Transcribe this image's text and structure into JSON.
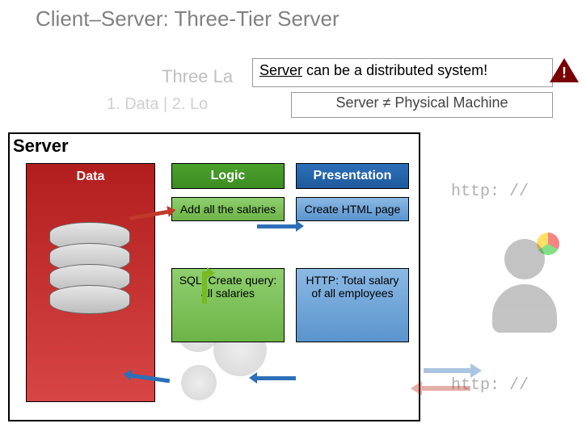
{
  "title": "Client–Server: Three-Tier Server",
  "subtitle_bg": "Three La",
  "layers_bg": "1. Data | 2. Lo",
  "callout1_prefix": "Server",
  "callout1_rest": " can be a distributed system!",
  "callout2": "Server ≠ Physical Machine",
  "warning": "!",
  "server_label": "Server",
  "col_data": "Data",
  "col_logic": "Logic",
  "col_pres": "Presentation",
  "logic_cell1": "Add all the salaries",
  "logic_cell2": "SQL: Create query: all salaries",
  "pres_cell1": "Create HTML page",
  "pres_cell2": "HTTP: Total salary of all employees",
  "http1": "http: //",
  "http2": "http: //"
}
